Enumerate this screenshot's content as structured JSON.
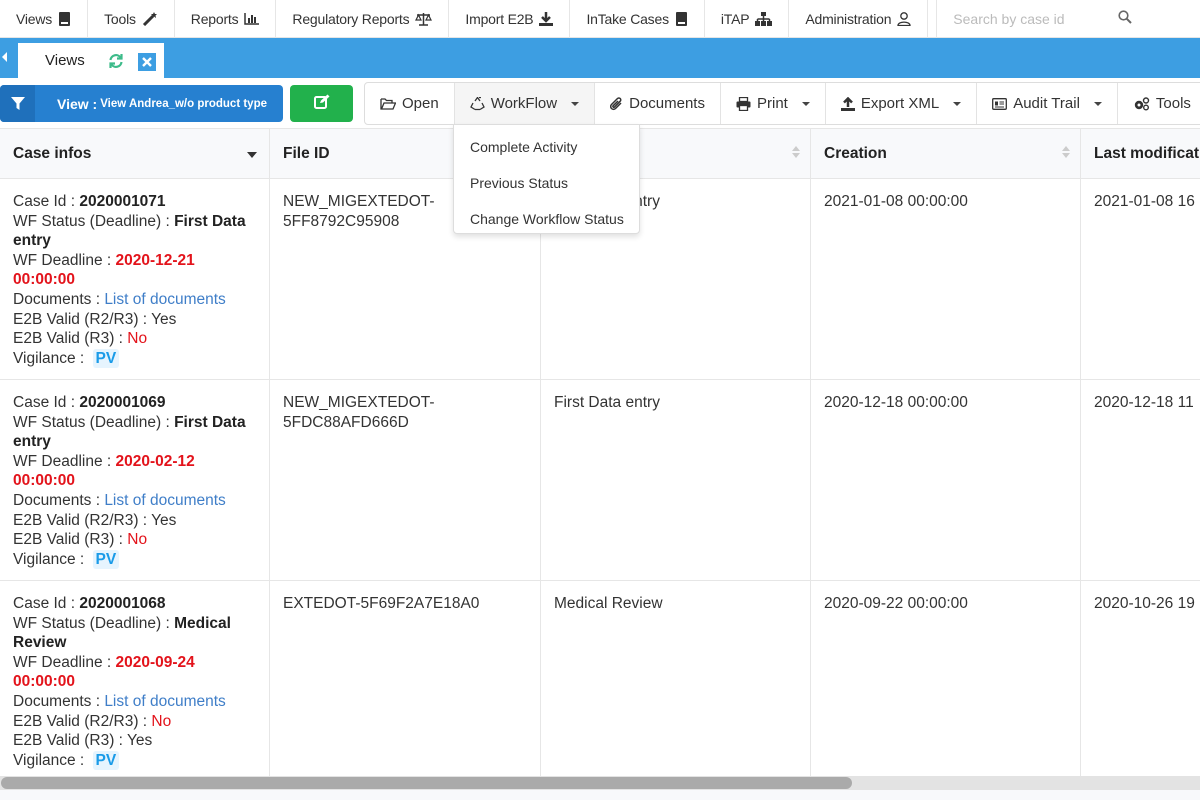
{
  "nav": {
    "items": [
      {
        "label": "Views",
        "icon": "book-icon"
      },
      {
        "label": "Tools",
        "icon": "magic-wand-icon"
      },
      {
        "label": "Reports",
        "icon": "bar-chart-icon"
      },
      {
        "label": "Regulatory Reports",
        "icon": "balance-scale-icon"
      },
      {
        "label": "Import E2B",
        "icon": "download-icon"
      },
      {
        "label": "InTake Cases",
        "icon": "book-icon"
      },
      {
        "label": "iTAP",
        "icon": "sitemap-icon"
      },
      {
        "label": "Administration",
        "icon": "user-icon"
      }
    ],
    "search_placeholder": "Search by case id"
  },
  "tabs": [
    {
      "label": "Views",
      "active": true
    }
  ],
  "view_selector": {
    "prefix": "View :",
    "name": "View Andrea_w/o product type"
  },
  "toolbar": {
    "buttons": [
      {
        "label": "Open",
        "icon": "folder-open-icon",
        "dropdown": false
      },
      {
        "label": "WorkFlow",
        "icon": "recycle-icon",
        "dropdown": true
      },
      {
        "label": "Documents",
        "icon": "paperclip-icon",
        "dropdown": false
      },
      {
        "label": "Print",
        "icon": "print-icon",
        "dropdown": true
      },
      {
        "label": "Export XML",
        "icon": "upload-icon",
        "dropdown": true
      },
      {
        "label": "Audit Trail",
        "icon": "id-card-icon",
        "dropdown": true
      },
      {
        "label": "Tools",
        "icon": "cogs-icon",
        "dropdown": true
      }
    ]
  },
  "workflow_menu": {
    "items": [
      "Complete Activity",
      "Previous Status",
      "Change Workflow Status"
    ]
  },
  "table": {
    "columns": [
      "Case infos",
      "File ID",
      "",
      "Creation",
      "Last modificati"
    ],
    "field_labels": {
      "case_id": "Case Id : ",
      "wf_status": "WF Status (Deadline) : ",
      "wf_deadline": "WF Deadline : ",
      "documents": "Documents : ",
      "e2b_r2r3": "E2B Valid (R2/R3) : ",
      "e2b_r3": "E2B Valid (R3) : ",
      "vigilance": "Vigilance : "
    },
    "rows": [
      {
        "case_id": "2020001071",
        "wf_status": "First Data entry",
        "wf_deadline": "2020-12-21 00:00:00",
        "documents": "List of documents",
        "e2b_r2r3": "Yes",
        "e2b_r3": "No",
        "vigilance": "PV",
        "file_id": "NEW_MIGEXTEDOT-5FF8792C95908",
        "status": "First Data entry",
        "creation": "2021-01-08 00:00:00",
        "last_modification": "2021-01-08 16"
      },
      {
        "case_id": "2020001069",
        "wf_status": "First Data entry",
        "wf_deadline": "2020-02-12 00:00:00",
        "documents": "List of documents",
        "e2b_r2r3": "Yes",
        "e2b_r3": "No",
        "vigilance": "PV",
        "file_id": "NEW_MIGEXTEDOT-5FDC88AFD666D",
        "status": "First Data entry",
        "creation": "2020-12-18 00:00:00",
        "last_modification": "2020-12-18 11"
      },
      {
        "case_id": "2020001068",
        "wf_status": "Medical Review",
        "wf_deadline": "2020-09-24 00:00:00",
        "documents": "List of documents",
        "e2b_r2r3": "No",
        "e2b_r3": "Yes",
        "vigilance": "PV",
        "file_id": "EXTEDOT-5F69F2A7E18A0",
        "status": "Medical Review",
        "creation": "2020-09-22 00:00:00",
        "last_modification": "2020-10-26 19"
      }
    ]
  },
  "colors": {
    "primary_blue": "#3d9ee2",
    "view_button": "#2680d0",
    "edit_button": "#22b14c",
    "alert_red": "#e3131b",
    "link_blue": "#3f7ec8",
    "pv_badge": "#1a9be8"
  }
}
